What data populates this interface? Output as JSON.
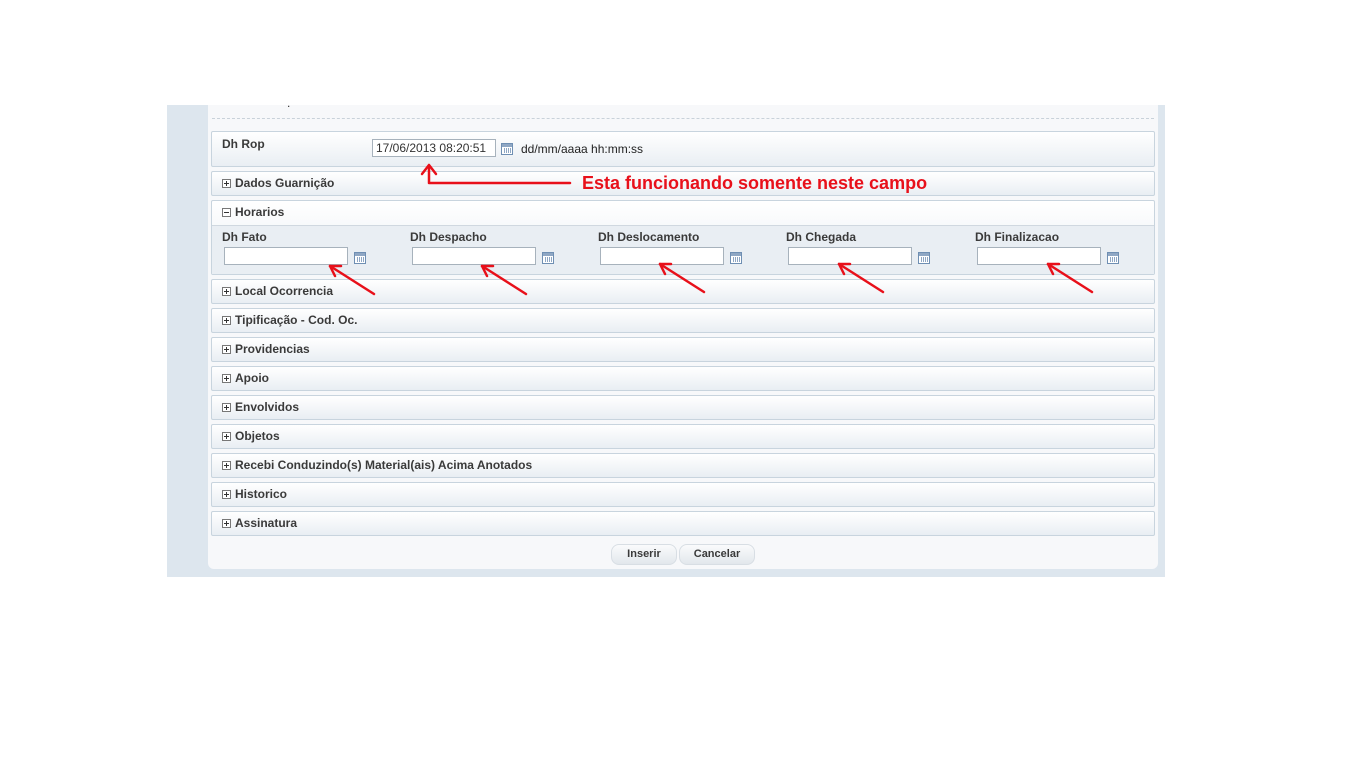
{
  "misc": {
    "dot": "."
  },
  "rop": {
    "label": "Dh Rop",
    "value": "17/06/2013 08:20:51",
    "format_hint": "dd/mm/aaaa hh:mm:ss"
  },
  "note": {
    "text": "Esta funcionando somente neste campo",
    "color": "#e8101a"
  },
  "sections": {
    "dados_guarnicao": "Dados Guarnição",
    "horarios": "Horarios",
    "local_ocorrencia": "Local Ocorrencia",
    "tipificacao": "Tipificação - Cod. Oc.",
    "providencias": "Providencias",
    "apoio": "Apoio",
    "envolvidos": "Envolvidos",
    "objetos": "Objetos",
    "recebi": "Recebi Conduzindo(s) Material(ais) Acima Anotados",
    "historico": "Historico",
    "assinatura": "Assinatura"
  },
  "horarios_fields": [
    {
      "label": "Dh Fato",
      "value": ""
    },
    {
      "label": "Dh Despacho",
      "value": ""
    },
    {
      "label": "Dh Deslocamento",
      "value": ""
    },
    {
      "label": "Dh Chegada",
      "value": ""
    },
    {
      "label": "Dh Finalizacao",
      "value": ""
    }
  ],
  "buttons": {
    "insert": "Inserir",
    "cancel": "Cancelar"
  },
  "icons": {
    "calendar": "calendar-icon",
    "expand": "plus-box-icon",
    "collapse": "minus-box-icon"
  }
}
